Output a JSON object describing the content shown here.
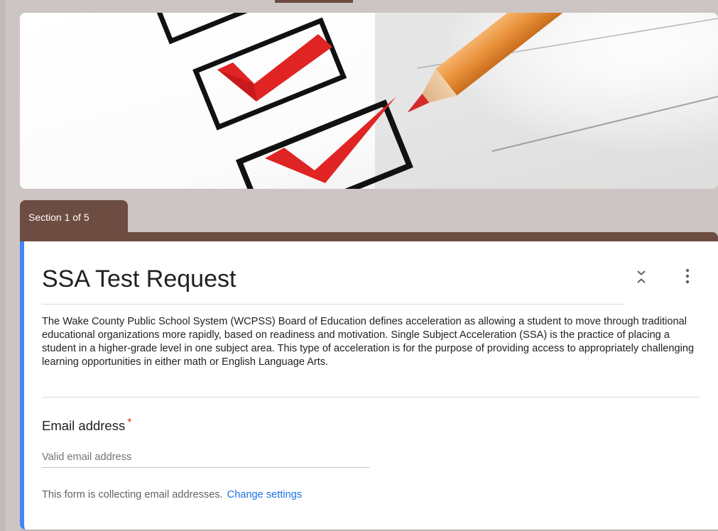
{
  "section": {
    "tab_label": "Section 1 of 5"
  },
  "form": {
    "title": "SSA Test Request",
    "description": "The Wake County Public School System (WCPSS) Board of Education defines acceleration as allowing a student to move through traditional educational organizations more rapidly, based on readiness and motivation. Single Subject Acceleration (SSA) is the practice of placing a student in a higher-grade level in one subject area. This type of acceleration is for the purpose of providing access to appropriately challenging learning opportunities in either math or English Language Arts."
  },
  "email_question": {
    "label": "Email address",
    "required_mark": "*",
    "placeholder": "Valid email address",
    "value": ""
  },
  "collection_note": {
    "text": "This form is collecting email addresses.",
    "link_label": "Change settings"
  },
  "icons": {
    "collapse": "collapse-icon",
    "more": "more-vert-icon"
  },
  "colors": {
    "theme": "#6d4c41",
    "accent_bar": "#4285f4",
    "link": "#1a73e8",
    "required": "#d93025",
    "page_bg": "#cdc5c3"
  }
}
